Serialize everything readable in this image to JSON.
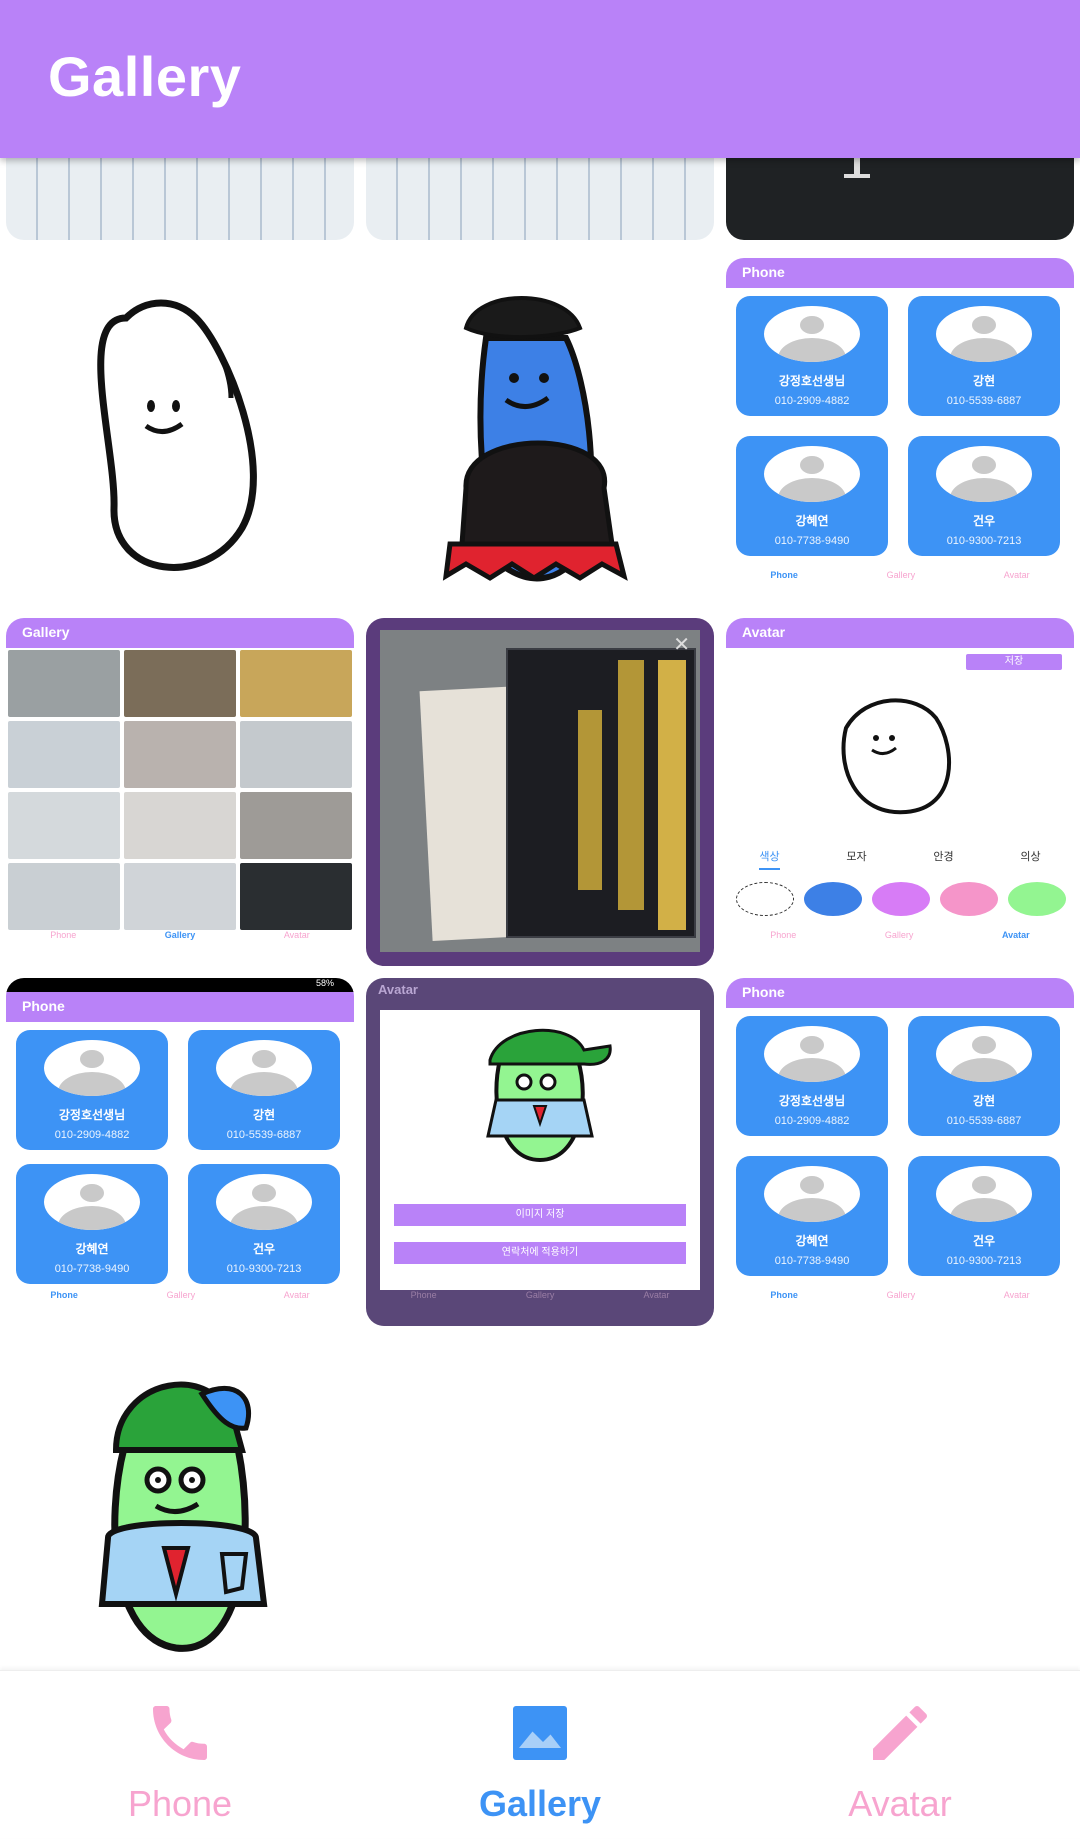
{
  "app_bar": {
    "title": "Gallery"
  },
  "thumbnails": [
    {
      "kind": "screenshot-phone",
      "header": "Phone",
      "contacts": [
        {
          "name": "강정호선생님",
          "phone": "010-2909-4882"
        },
        {
          "name": "강현",
          "phone": "010-5539-6887"
        },
        {
          "name": "강혜연",
          "phone": "010-7738-9490"
        },
        {
          "name": "건우",
          "phone": "010-9300-7213"
        }
      ],
      "nav": [
        "Phone",
        "Gallery",
        "Avatar"
      ]
    },
    {
      "kind": "screenshot-gallery",
      "header": "Gallery",
      "nav": [
        "Phone",
        "Gallery",
        "Avatar"
      ]
    },
    {
      "kind": "screenshot-avatar",
      "header": "Avatar",
      "save": "저장",
      "tabs": [
        "색상",
        "모자",
        "안경",
        "의상"
      ],
      "nav": [
        "Phone",
        "Gallery",
        "Avatar"
      ]
    },
    {
      "kind": "screenshot-phone-2",
      "header": "Phone",
      "status": "58%",
      "contacts": [
        {
          "name": "강정호선생님",
          "phone": "010-2909-4882"
        },
        {
          "name": "강현",
          "phone": "010-5539-6887"
        },
        {
          "name": "강혜연",
          "phone": "010-7738-9490"
        },
        {
          "name": "건우",
          "phone": "010-9300-7213"
        }
      ],
      "nav": [
        "Phone",
        "Gallery",
        "Avatar"
      ]
    },
    {
      "kind": "screenshot-avatar-dialog",
      "header": "Avatar",
      "buttons": [
        "이미지 저장",
        "연락처에 적용하기"
      ],
      "nav": [
        "Phone",
        "Gallery",
        "Avatar"
      ]
    },
    {
      "kind": "screenshot-phone-3",
      "header": "Phone",
      "contacts": [
        {
          "name": "강정호선생님",
          "phone": "010-2909-4882"
        },
        {
          "name": "강현",
          "phone": "010-5539-6887"
        },
        {
          "name": "강혜연",
          "phone": "010-7738-9490"
        },
        {
          "name": "건우",
          "phone": "010-9300-7213"
        }
      ],
      "nav": [
        "Phone",
        "Gallery",
        "Avatar"
      ]
    }
  ],
  "bottom_nav": {
    "items": [
      {
        "label": "Phone",
        "icon": "phone-icon",
        "color": "#f7a4cf"
      },
      {
        "label": "Gallery",
        "icon": "gallery-icon",
        "color": "#3d93f5",
        "selected": true
      },
      {
        "label": "Avatar",
        "icon": "pencil-icon",
        "color": "#f7a4cf"
      }
    ]
  },
  "colors": {
    "accent": "#b982f8",
    "selected": "#3d93f5",
    "inactive": "#f7a4cf"
  }
}
